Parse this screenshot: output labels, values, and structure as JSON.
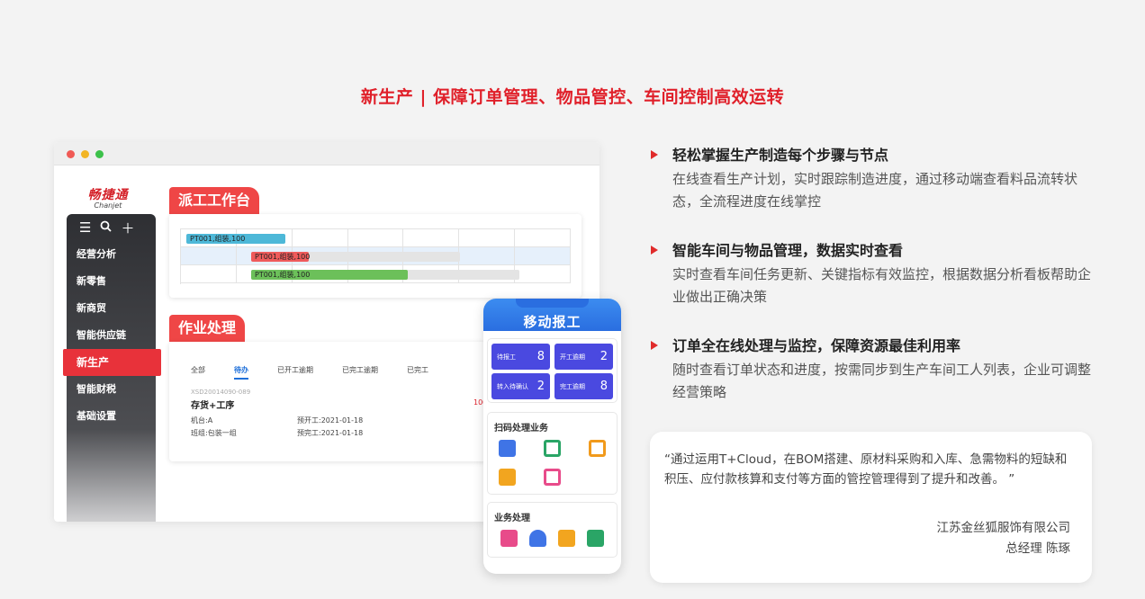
{
  "headline": "新生产 | 保障订单管理、物品管控、车间控制高效运转",
  "logo": {
    "cn": "畅捷通",
    "en": "Chanjet"
  },
  "sidebar": {
    "items": [
      {
        "label": "经营分析"
      },
      {
        "label": "新零售"
      },
      {
        "label": "新商贸"
      },
      {
        "label": "智能供应链"
      },
      {
        "label": "新生产",
        "active": true
      },
      {
        "label": "智能财税"
      },
      {
        "label": "基础设置"
      }
    ]
  },
  "dispatch": {
    "title": "派工工作台",
    "rows": [
      {
        "label": "PT001,组装,100",
        "color": "#4db8d8"
      },
      {
        "label": "PT001,组装,100",
        "color": "#ef5b5b"
      },
      {
        "label": "PT001,组装,100",
        "color": "#6cc05a"
      }
    ]
  },
  "jobs": {
    "title": "作业处理",
    "tabs": [
      {
        "label": "全部"
      },
      {
        "label": "待办",
        "active": true
      },
      {
        "label": "已开工逾期"
      },
      {
        "label": "已完工逾期"
      },
      {
        "label": "已完工"
      }
    ],
    "order_no": "XSD20014090-089",
    "name": "存货+工序",
    "machine": "机台:A",
    "start": "预开工:2021-01-18",
    "team": "班组:包装一组",
    "finish": "预完工:2021-01-18",
    "qty": "100"
  },
  "phone": {
    "title": "移动报工",
    "stats": [
      {
        "label": "待报工",
        "value": "8"
      },
      {
        "label": "开工逾期",
        "value": "2"
      },
      {
        "label": "转入待确认",
        "value": "2"
      },
      {
        "label": "完工逾期",
        "value": "8"
      }
    ],
    "scan_title": "扫码处理业务",
    "biz_title": "业务处理"
  },
  "features": [
    {
      "title": "轻松掌握生产制造每个步骤与节点",
      "desc": "在线查看生产计划，实时跟踪制造进度，通过移动端查看料品流转状态，全流程进度在线掌控"
    },
    {
      "title": "智能车间与物品管理，数据实时查看",
      "desc": "实时查看车间任务更新、关键指标有效监控，根据数据分析看板帮助企业做出正确决策"
    },
    {
      "title": "订单全在线处理与监控，保障资源最佳利用率",
      "desc": "随时查看订单状态和进度，按需同步到生产车间工人列表，企业可调整经营策略"
    }
  ],
  "quote": {
    "text": "“通过运用T+Cloud，在BOM搭建、原材料采购和入库、急需物料的短缺和积压、应付款核算和支付等方面的管控管理得到了提升和改善。 ”",
    "company": "江苏金丝狐服饰有限公司",
    "person": "总经理 陈琢"
  }
}
